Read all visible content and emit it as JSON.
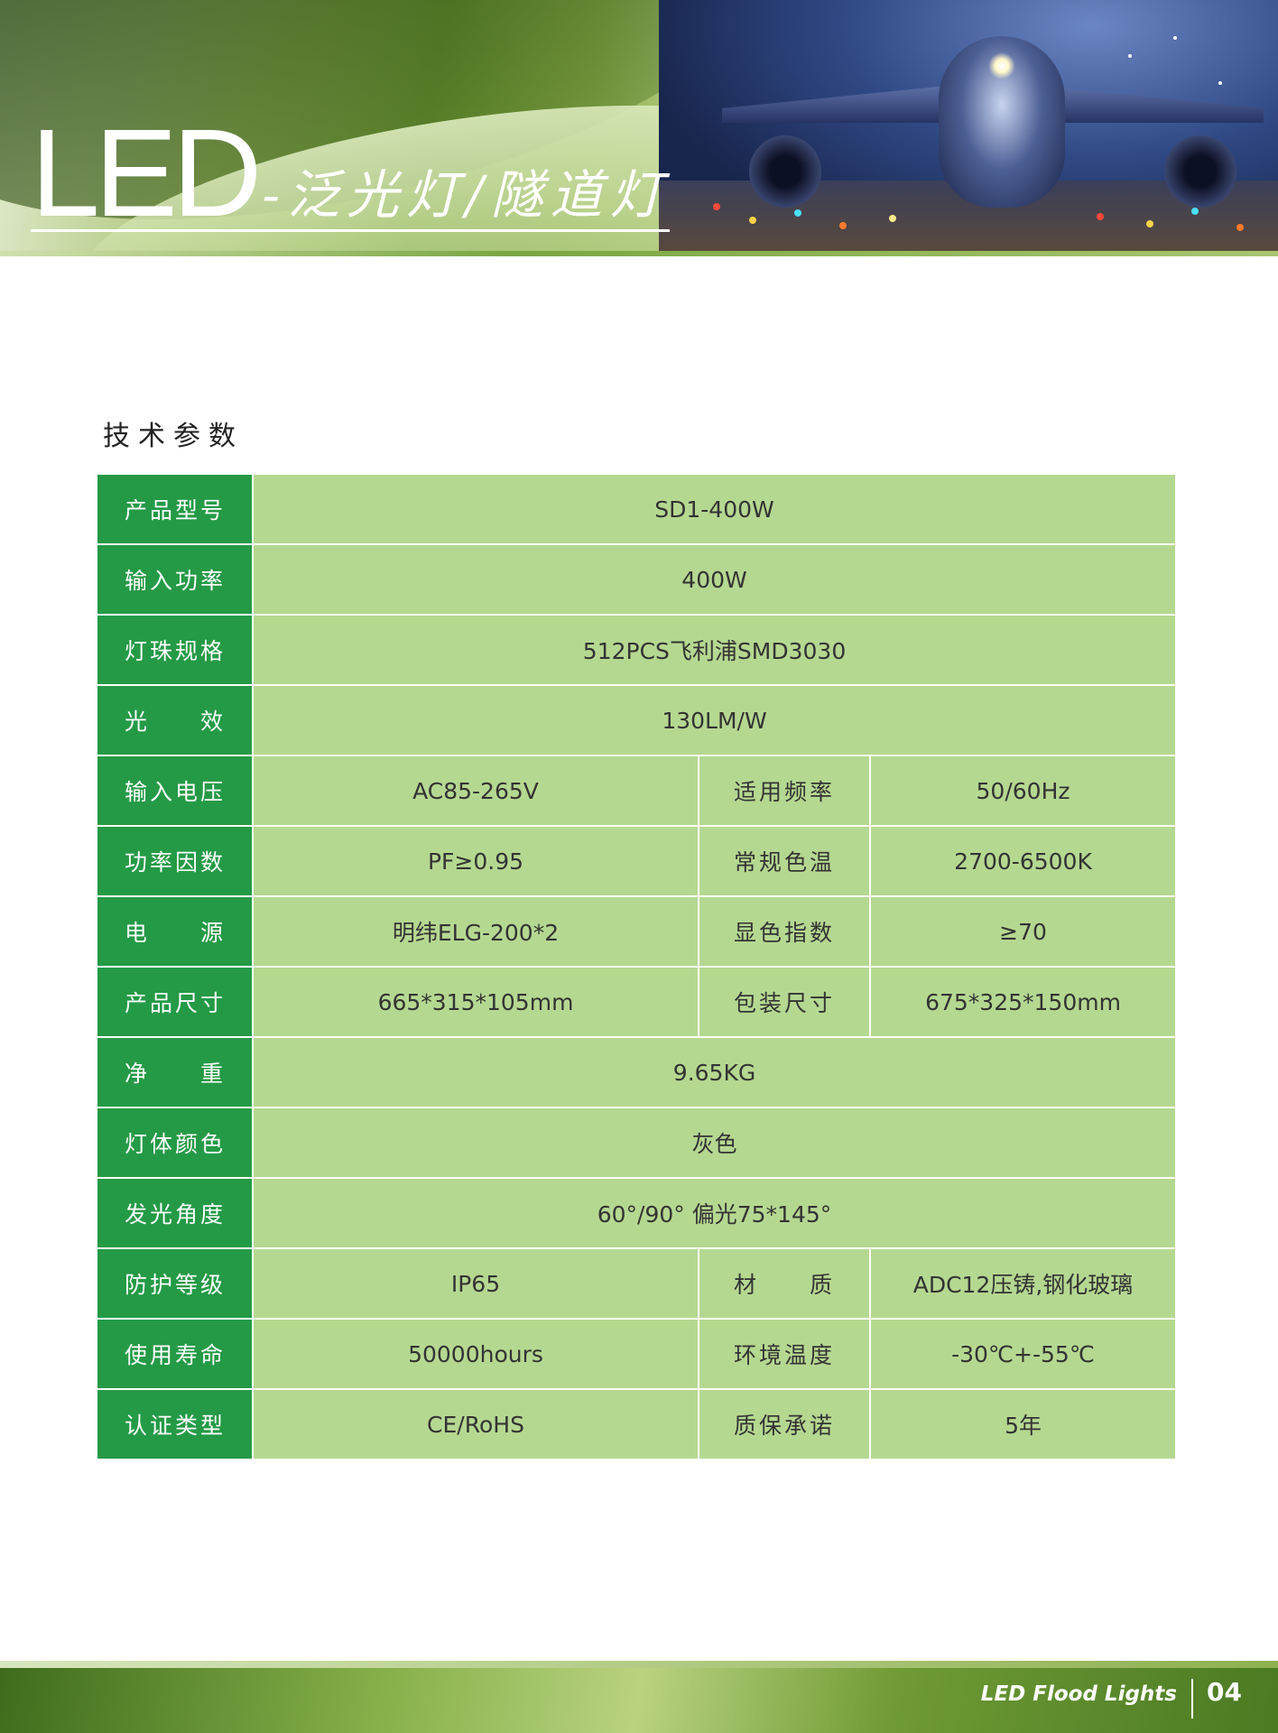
{
  "header": {
    "title_main": "LED",
    "title_sub": "-泛光灯/隧道灯"
  },
  "section_title": "技术参数",
  "specs": [
    {
      "label": "产品型号",
      "value": "SD1-400W"
    },
    {
      "label": "输入功率",
      "value": "400W"
    },
    {
      "label": "灯珠规格",
      "value": "512PCS飞利浦SMD3030"
    },
    {
      "label": "光　　效",
      "value": "130LM/W"
    },
    {
      "label": "输入电压",
      "value": "AC85-265V",
      "label2": "适用频率",
      "value2": "50/60Hz"
    },
    {
      "label": "功率因数",
      "value": "PF≥0.95",
      "label2": "常规色温",
      "value2": "2700-6500K"
    },
    {
      "label": "电　　源",
      "value": "明纬ELG-200*2",
      "label2": "显色指数",
      "value2": "≥70"
    },
    {
      "label": "产品尺寸",
      "value": "665*315*105mm",
      "label2": "包装尺寸",
      "value2": "675*325*150mm"
    },
    {
      "label": "净　　重",
      "value": "9.65KG"
    },
    {
      "label": "灯体颜色",
      "value": "灰色"
    },
    {
      "label": "发光角度",
      "value": "60°/90° 偏光75*145°"
    },
    {
      "label": "防护等级",
      "value": "IP65",
      "label2": "材　　质",
      "value2": "ADC12压铸,钢化玻璃"
    },
    {
      "label": "使用寿命",
      "value": "50000hours",
      "label2": "环境温度",
      "value2": "-30℃+-55℃"
    },
    {
      "label": "认证类型",
      "value": "CE/RoHS",
      "label2": "质保承诺",
      "value2": "5年"
    }
  ],
  "footer": {
    "text": "LED Flood Lights",
    "page": "04"
  },
  "colors": {
    "label_green": "#249a46",
    "value_green": "#b5d891"
  }
}
